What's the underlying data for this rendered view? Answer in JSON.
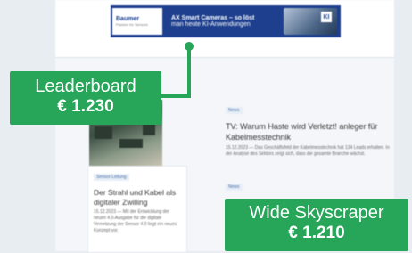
{
  "banner": {
    "logo_text": "Baumer",
    "logo_sub": "Passion for Sensors",
    "line1": "AX Smart Cameras – so löst",
    "line2": "man heute KI-Anwendungen",
    "badge": "KI"
  },
  "articles": [
    {
      "tag": "News",
      "title": "TV: Warum Haste wird Verletzt! anleger für Kabelmesstechnik",
      "excerpt": "15.12.2023 — Das Geschäftsfeld der Kabelmesstechnik hat 134 Leads erhalten. In der Analyse des Sektors zeigt sich, dass die gesamte Branche wächst."
    },
    {
      "tag": "Sensor Leitung",
      "title": "Der Strahl und Kabel als digitaler Zwilling",
      "excerpt": "15.12.2023 — Mit der Entwicklung der neuen 4.0-Ausgabe für die digitale Vernetzung der Sensor 4.0 liegt ein neues Konzept vor."
    },
    {
      "tag": "News"
    }
  ],
  "callouts": {
    "leaderboard": {
      "name": "Leaderboard",
      "price": "€ 1.230"
    },
    "skyscraper": {
      "name": "Wide Skyscraper",
      "price": "€ 1.210"
    }
  },
  "colors": {
    "callout_green": "#27a65a",
    "banner_blue": "#1d3f8e"
  }
}
